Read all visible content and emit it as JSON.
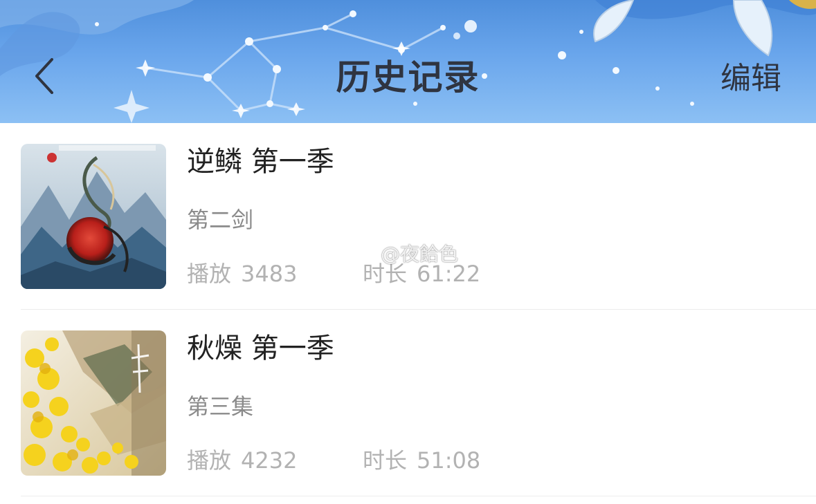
{
  "header": {
    "title": "历史记录",
    "edit_label": "编辑",
    "back_icon": "chevron-left-icon",
    "bg_colors": [
      "#4f8fdc",
      "#8cc0f4"
    ]
  },
  "history": [
    {
      "title": "逆鳞 第一季",
      "episode": "第二剑",
      "play_label": "播放",
      "play_count": "3483",
      "duration_label": "时长",
      "duration": "61:22"
    },
    {
      "title": "秋燥 第一季",
      "episode": "第三集",
      "play_label": "播放",
      "play_count": "4232",
      "duration_label": "时长",
      "duration": "51:08"
    }
  ],
  "watermark": {
    "text": "@夜餄色"
  }
}
